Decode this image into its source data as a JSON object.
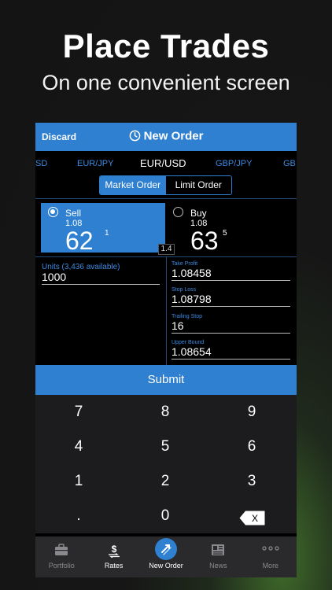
{
  "promo": {
    "headline": "Place Trades",
    "subheadline": "On one convenient screen"
  },
  "header": {
    "discard_label": "Discard",
    "title": "New Order",
    "title_icon": "clock-icon"
  },
  "currency_pairs": [
    {
      "label": "SD",
      "active": false
    },
    {
      "label": "EUR/JPY",
      "active": false
    },
    {
      "label": "EUR/USD",
      "active": true
    },
    {
      "label": "GBP/JPY",
      "active": false
    },
    {
      "label": "GB",
      "active": false
    }
  ],
  "order_type": {
    "options": [
      "Market Order",
      "Limit Order"
    ],
    "selected": "Market Order"
  },
  "quote": {
    "sell": {
      "label": "Sell",
      "prefix": "1.08",
      "big": "62",
      "pip": "1",
      "selected": true
    },
    "buy": {
      "label": "Buy",
      "prefix": "1.08",
      "big": "63",
      "pip": "5",
      "selected": false
    },
    "spread": "1.4"
  },
  "fields": {
    "units": {
      "label": "Units (3,436 available)",
      "value": "1000"
    },
    "take_profit": {
      "label": "Take Profit",
      "value": "1.08458"
    },
    "stop_loss": {
      "label": "Stop Loss",
      "value": "1.08798"
    },
    "trailing_stop": {
      "label": "Trailing Stop",
      "value": "16"
    },
    "upper_bound": {
      "label": "Upper Bound",
      "value": "1.08654"
    }
  },
  "submit_label": "Submit",
  "keypad": {
    "keys": [
      "7",
      "8",
      "9",
      "4",
      "5",
      "6",
      "1",
      "2",
      "3",
      ".",
      "0"
    ],
    "backspace_glyph": "X"
  },
  "tabs": [
    {
      "label": "Portfolio",
      "icon": "briefcase-icon",
      "active": false
    },
    {
      "label": "Rates",
      "icon": "dollar-exchange-icon",
      "active": false
    },
    {
      "label": "New Order",
      "icon": "trade-arrows-icon",
      "active": true
    },
    {
      "label": "News",
      "icon": "newspaper-icon",
      "active": false
    },
    {
      "label": "More",
      "icon": "ellipsis-icon",
      "active": false
    }
  ],
  "colors": {
    "accent": "#2f80d1",
    "link": "#3d8ae0",
    "keypad_bg": "#1c1c1e",
    "tabbar_bg": "#2a2a2c"
  }
}
